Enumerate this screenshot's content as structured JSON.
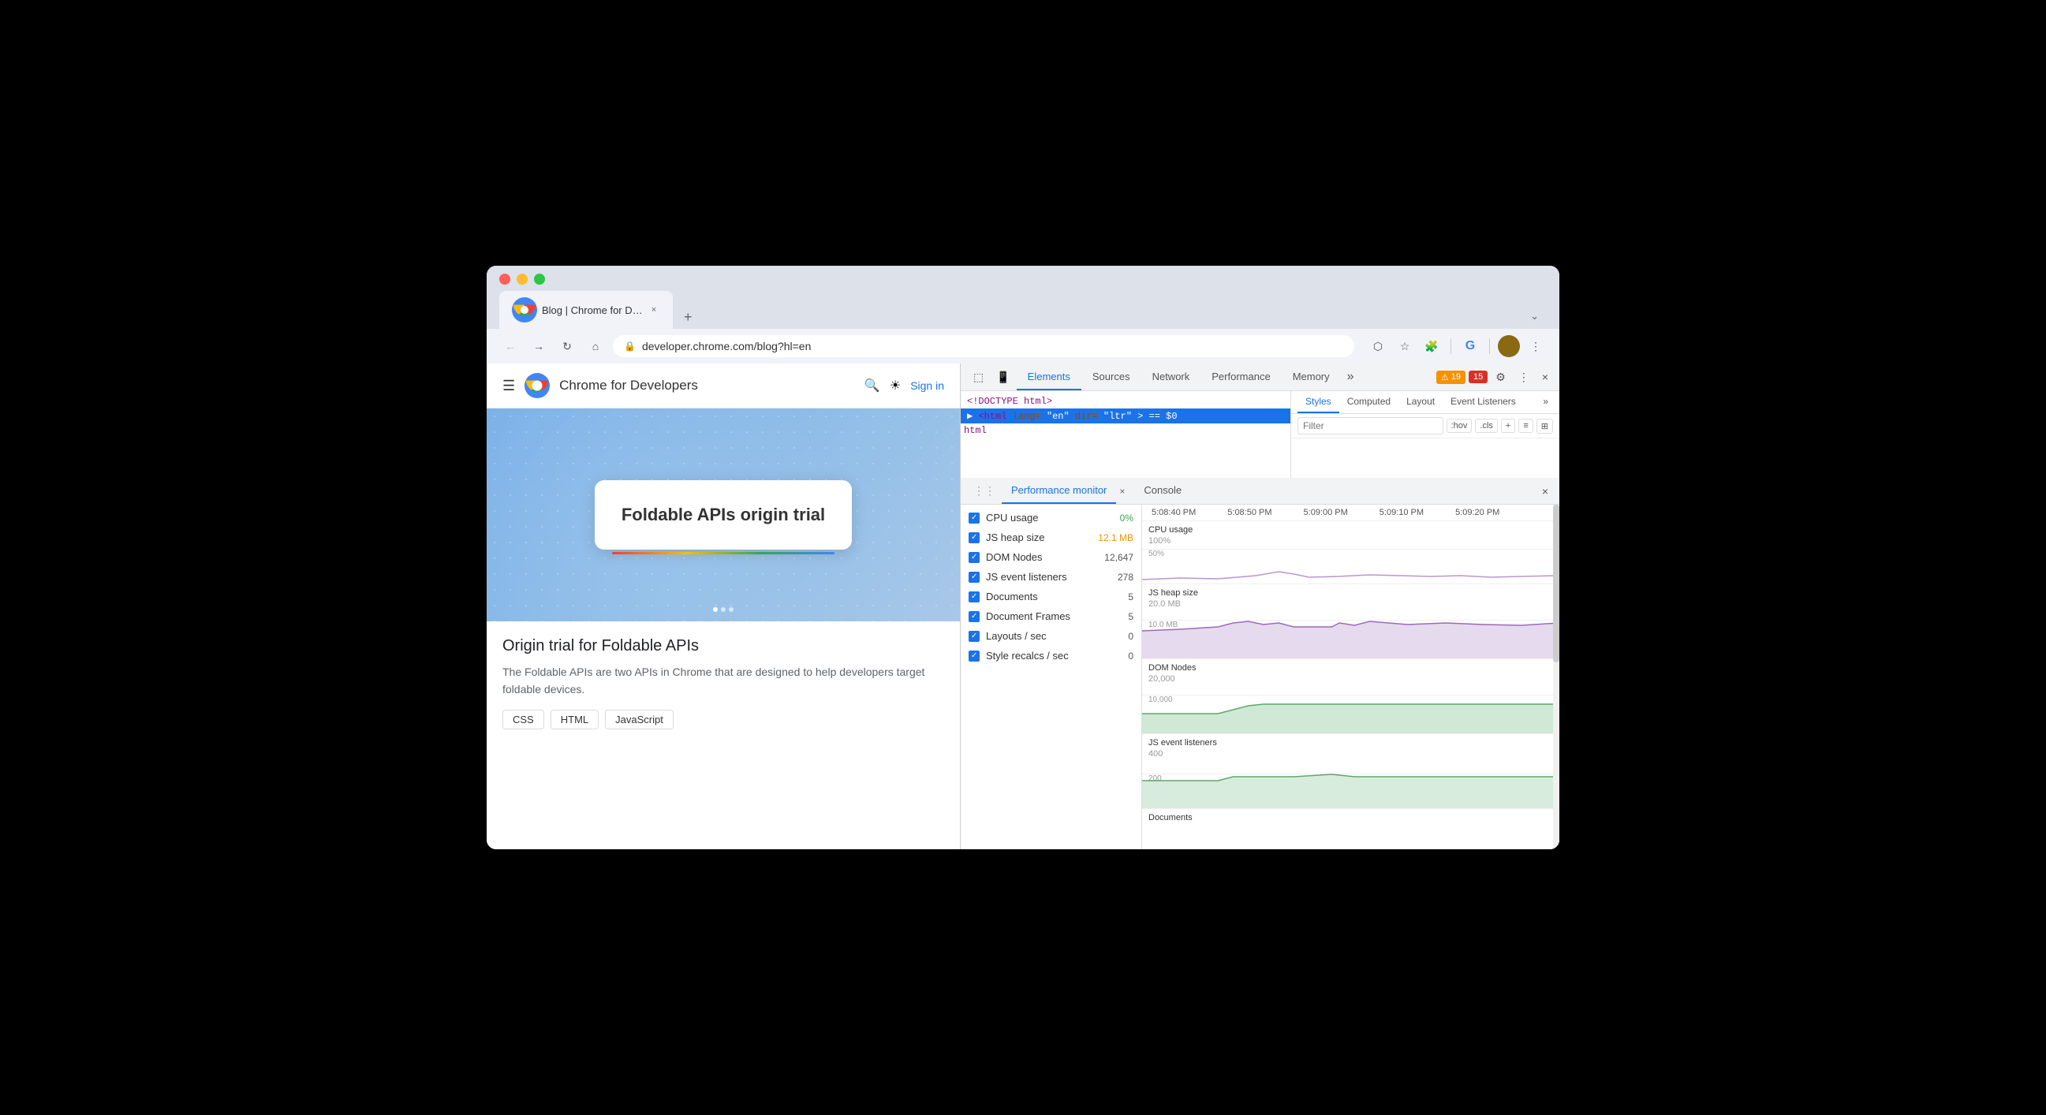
{
  "browser": {
    "tab_title": "Blog | Chrome for Develope...",
    "tab_favicon": "chrome",
    "url": "developer.chrome.com/blog?hl=en",
    "new_tab_label": "+",
    "more_tabs_label": "⌄"
  },
  "toolbar": {
    "back_label": "←",
    "forward_label": "→",
    "refresh_label": "↻",
    "home_label": "⌂",
    "extensions_label": "🧩",
    "bookmark_label": "☆",
    "cast_label": "📺",
    "google_label": "G",
    "more_label": "⋮"
  },
  "website": {
    "menu_label": "☰",
    "site_title": "Chrome for Developers",
    "search_label": "🔍",
    "theme_label": "☀",
    "sign_in_label": "Sign in",
    "hero_title": "Foldable APIs origin trial",
    "post_title": "Origin trial for Foldable APIs",
    "post_desc": "The Foldable APIs are two APIs in Chrome that are designed to help developers target foldable devices.",
    "tags": [
      "CSS",
      "HTML",
      "JavaScript"
    ]
  },
  "devtools": {
    "tabs": [
      "Elements",
      "Sources",
      "Network",
      "Performance",
      "Memory"
    ],
    "active_tab": "Elements",
    "more_tabs": "»",
    "warning_count": "19",
    "error_count": "15",
    "close_label": "×",
    "html_line1": "<!DOCTYPE html>",
    "html_line2": "<html lang=\"en\" dir=\"ltr\"> == $0",
    "html_line3": "html",
    "styles_tabs": [
      "Styles",
      "Computed",
      "Layout",
      "Event Listeners"
    ],
    "styles_active": "Styles",
    "styles_more": "»",
    "filter_placeholder": "Filter",
    "filter_hov": ":hov",
    "filter_cls": ".cls",
    "filter_plus": "+",
    "perf_monitor": {
      "tab_label": "Performance monitor",
      "console_label": "Console",
      "metrics": [
        {
          "name": "CPU usage",
          "value": "0%",
          "color": "green"
        },
        {
          "name": "JS heap size",
          "value": "12.1 MB",
          "color": "yellow"
        },
        {
          "name": "DOM Nodes",
          "value": "12,647",
          "color": "normal"
        },
        {
          "name": "JS event listeners",
          "value": "278",
          "color": "normal"
        },
        {
          "name": "Documents",
          "value": "5",
          "color": "normal"
        },
        {
          "name": "Document Frames",
          "value": "5",
          "color": "normal"
        },
        {
          "name": "Layouts / sec",
          "value": "0",
          "color": "normal"
        },
        {
          "name": "Style recalcs / sec",
          "value": "0",
          "color": "normal"
        }
      ],
      "chart_times": [
        "5:08:40 PM",
        "5:08:50 PM",
        "5:09:00 PM",
        "5:09:10 PM",
        "5:09:20 PM"
      ],
      "cpu_label": "CPU usage",
      "cpu_100": "100%",
      "cpu_50": "50%",
      "heap_label": "JS heap size",
      "heap_20mb": "20.0 MB",
      "heap_10mb": "10.0 MB",
      "dom_label": "DOM Nodes",
      "dom_20k": "20,000",
      "dom_10k": "10,000",
      "js_label": "JS event listeners",
      "js_400": "400",
      "js_200": "200",
      "docs_label": "Documents"
    }
  }
}
